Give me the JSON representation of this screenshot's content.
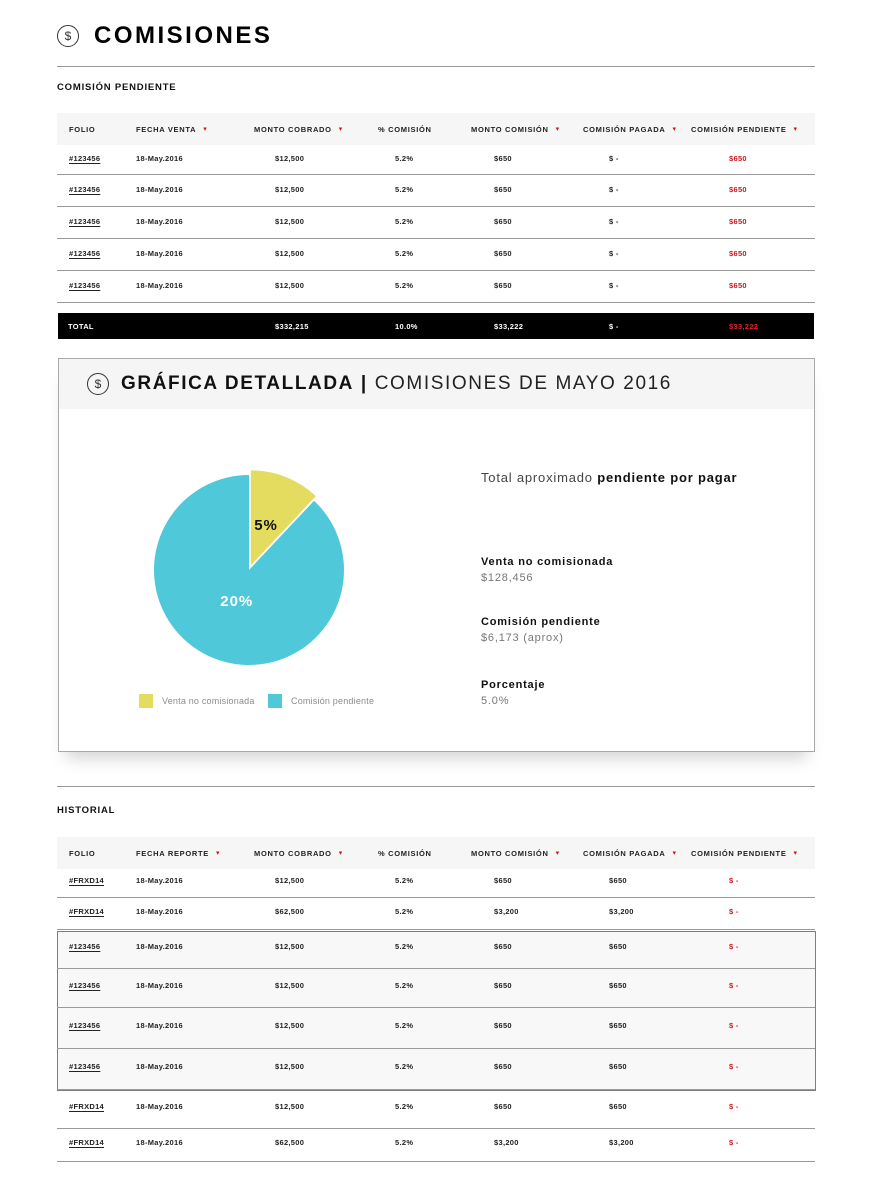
{
  "page": {
    "title": "COMISIONES",
    "icon": "dollar-circle-icon"
  },
  "pending": {
    "section_title": "COMISIÓN PENDIENTE",
    "columns": [
      "FOLIO",
      "FECHA VENTA",
      "MONTO COBRADO",
      "% COMISIÓN",
      "MONTO COMISIÓN",
      "COMISIÓN PAGADA",
      "COMISIÓN PENDIENTE"
    ],
    "rows": [
      [
        "#123456",
        "18-May.2016",
        "$12,500",
        "5.2%",
        "$650",
        "$ -",
        "$650"
      ],
      [
        "#123456",
        "18-May.2016",
        "$12,500",
        "5.2%",
        "$650",
        "$ -",
        "$650"
      ],
      [
        "#123456",
        "18-May.2016",
        "$12,500",
        "5.2%",
        "$650",
        "$ -",
        "$650"
      ],
      [
        "#123456",
        "18-May.2016",
        "$12,500",
        "5.2%",
        "$650",
        "$ -",
        "$650"
      ],
      [
        "#123456",
        "18-May.2016",
        "$12,500",
        "5.2%",
        "$650",
        "$ -",
        "$650"
      ]
    ],
    "total": {
      "label": "TOTAL",
      "monto_cobrado": "$332,215",
      "comision_pct": "10.0%",
      "monto_comision": "$33,222",
      "pagada": "$ -",
      "pendiente": "$33,222"
    }
  },
  "chart_card": {
    "title_bold": "GRÁFICA DETALLADA",
    "separator": "|",
    "title_light": "COMISIONES DE MAYO 2016",
    "headline_light": "Total aproximado",
    "headline_bold": "pendiente por pagar",
    "stats": [
      {
        "label": "Venta no comisionada",
        "value": "$128,456"
      },
      {
        "label": "Comisión pendiente",
        "value": "$6,173 (aprox)"
      },
      {
        "label": "Porcentaje",
        "value": "5.0%"
      }
    ]
  },
  "chart_data": {
    "type": "pie",
    "title": "",
    "slices": [
      {
        "label": "Venta no comisionada",
        "value": 12,
        "display": "5%",
        "color": "#e4dc5f"
      },
      {
        "label": "Comisión pendiente",
        "value": 88,
        "display": "20%",
        "color": "#4fc8d9"
      }
    ],
    "legend": [
      "Venta no comisionada",
      "Comisión pendiente"
    ],
    "legend_position": "bottom",
    "exploded_slice": 0
  },
  "history": {
    "section_title": "HISTORIAL",
    "columns": [
      "FOLIO",
      "FECHA REPORTE",
      "MONTO COBRADO",
      "% COMISIÓN",
      "MONTO COMISIÓN",
      "COMISIÓN PAGADA",
      "COMISIÓN PENDIENTE"
    ],
    "rows": [
      [
        "#FRXD14",
        "18-May.2016",
        "$12,500",
        "5.2%",
        "$650",
        "$650",
        "$ -"
      ],
      [
        "#FRXD14",
        "18-May.2016",
        "$62,500",
        "5.2%",
        "$3,200",
        "$3,200",
        "$ -"
      ],
      [
        "#123456",
        "18-May.2016",
        "$12,500",
        "5.2%",
        "$650",
        "$650",
        "$ -"
      ],
      [
        "#123456",
        "18-May.2016",
        "$12,500",
        "5.2%",
        "$650",
        "$650",
        "$ -"
      ],
      [
        "#123456",
        "18-May.2016",
        "$12,500",
        "5.2%",
        "$650",
        "$650",
        "$ -"
      ],
      [
        "#123456",
        "18-May.2016",
        "$12,500",
        "5.2%",
        "$650",
        "$650",
        "$ -"
      ],
      [
        "#FRXD14",
        "18-May.2016",
        "$12,500",
        "5.2%",
        "$650",
        "$650",
        "$ -"
      ],
      [
        "#FRXD14",
        "18-May.2016",
        "$62,500",
        "5.2%",
        "$3,200",
        "$3,200",
        "$ -"
      ]
    ]
  },
  "colors": {
    "accent_red": "#d4141c",
    "pie_yellow": "#e4dc5f",
    "pie_cyan": "#4fc8d9",
    "header_bg": "#f6f6f6"
  }
}
